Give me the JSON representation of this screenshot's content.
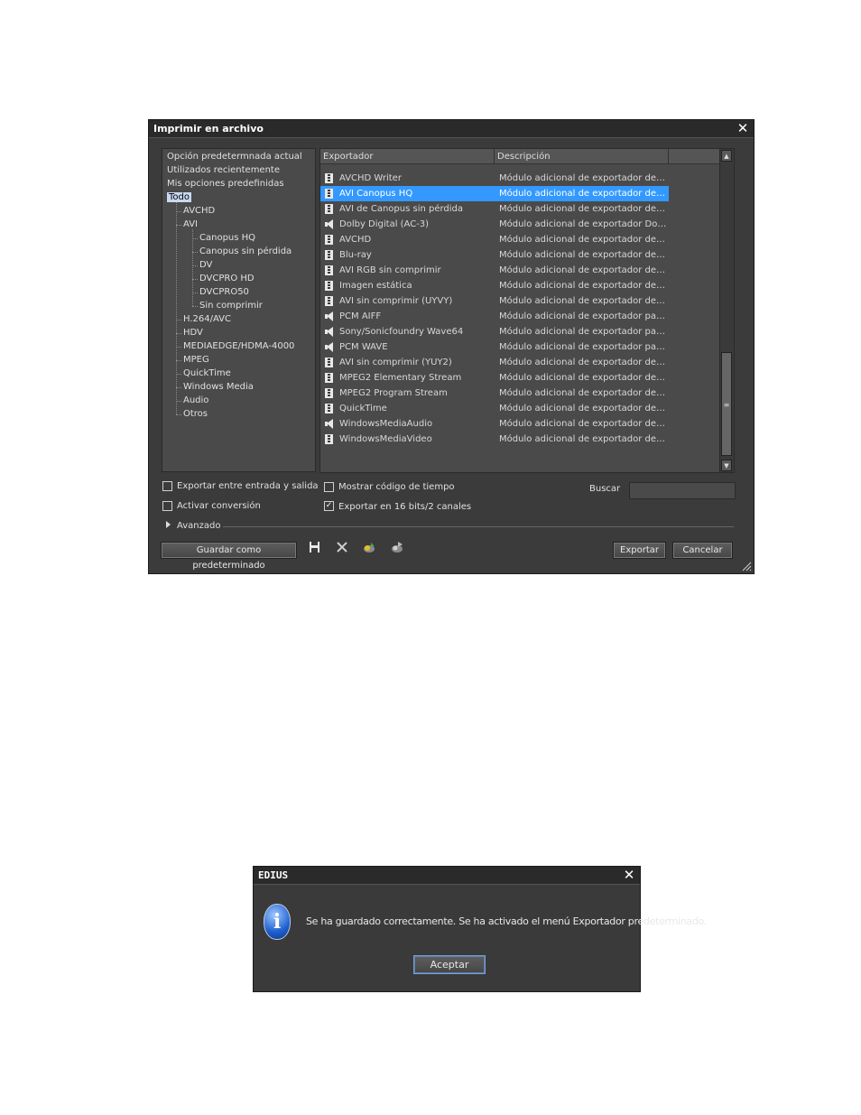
{
  "export_dialog": {
    "title": "Imprimir en archivo",
    "tree": [
      {
        "label": "Opción predetermnada actual",
        "level": 0
      },
      {
        "label": "Utilizados recientemente",
        "level": 0
      },
      {
        "label": "Mis opciones predefinidas",
        "level": 0
      },
      {
        "label": "Todo",
        "level": 0,
        "selected": true
      },
      {
        "label": "AVCHD",
        "level": 1
      },
      {
        "label": "AVI",
        "level": 1
      },
      {
        "label": "Canopus HQ",
        "level": 2
      },
      {
        "label": "Canopus sin pérdida",
        "level": 2
      },
      {
        "label": "DV",
        "level": 2
      },
      {
        "label": "DVCPRO HD",
        "level": 2
      },
      {
        "label": "DVCPRO50",
        "level": 2
      },
      {
        "label": "Sin comprimir",
        "level": 2
      },
      {
        "label": "H.264/AVC",
        "level": 1
      },
      {
        "label": "HDV",
        "level": 1
      },
      {
        "label": "MEDIAEDGE/HDMA-4000",
        "level": 1
      },
      {
        "label": "MPEG",
        "level": 1
      },
      {
        "label": "QuickTime",
        "level": 1
      },
      {
        "label": "Windows Media",
        "level": 1
      },
      {
        "label": "Audio",
        "level": 1
      },
      {
        "label": "Otros",
        "level": 1
      }
    ],
    "columns": {
      "exporter": "Exportador",
      "description": "Descripción"
    },
    "rows": [
      {
        "name": "AVCHD Writer",
        "desc": "Módulo adicional de exportador de for…",
        "icon": "film"
      },
      {
        "name": "AVI Canopus HQ",
        "desc": "Módulo adicional de exportador de ar…",
        "icon": "film",
        "selected": true
      },
      {
        "name": "AVI de Canopus sin pérdida",
        "desc": "Módulo adicional de exportador de ar…",
        "icon": "film"
      },
      {
        "name": "Dolby Digital (AC-3)",
        "desc": "Módulo adicional de exportador Dolby…",
        "icon": "speaker"
      },
      {
        "name": "AVCHD",
        "desc": "Módulo adicional de exportador de AV…",
        "icon": "film"
      },
      {
        "name": "Blu-ray",
        "desc": "Módulo adicional de exportador de Blu…",
        "icon": "film"
      },
      {
        "name": "AVI RGB sin comprimir",
        "desc": "Módulo adicional de exportador de ar…",
        "icon": "film"
      },
      {
        "name": "Imagen estática",
        "desc": "Módulo adicional de exportador de im…",
        "icon": "film"
      },
      {
        "name": "AVI sin comprimir (UYVY)",
        "desc": "Módulo adicional de exportador de ar…",
        "icon": "film"
      },
      {
        "name": "PCM AIFF",
        "desc": "Módulo adicional de exportador para …",
        "icon": "speaker"
      },
      {
        "name": "Sony/Sonicfoundry Wave64",
        "desc": "Módulo adicional de exportador para …",
        "icon": "speaker"
      },
      {
        "name": "PCM WAVE",
        "desc": "Módulo adicional de exportador para …",
        "icon": "speaker"
      },
      {
        "name": "AVI sin comprimir (YUY2)",
        "desc": "Módulo adicional de exportador de ar…",
        "icon": "film"
      },
      {
        "name": "MPEG2 Elementary Stream",
        "desc": "Módulo adicional de exportador de MP…",
        "icon": "film"
      },
      {
        "name": "MPEG2 Program Stream",
        "desc": "Módulo adicional de exportador de MP…",
        "icon": "film"
      },
      {
        "name": "QuickTime",
        "desc": "Módulo adicional de exportador de Qu…",
        "icon": "film"
      },
      {
        "name": "WindowsMediaAudio",
        "desc": "Módulo adicional de exportador de W…",
        "icon": "speaker"
      },
      {
        "name": "WindowsMediaVideo",
        "desc": "Módulo adicional de exportador de W…",
        "icon": "film"
      }
    ],
    "options": {
      "export_in_out": {
        "label": "Exportar entre entrada y salida",
        "checked": false
      },
      "enable_conversion": {
        "label": "Activar conversión",
        "checked": false
      },
      "show_timecode": {
        "label": "Mostrar código de tiempo",
        "checked": false
      },
      "export_16bit": {
        "label": "Exportar en 16 bits/2 canales",
        "checked": true
      },
      "search_label": "Buscar",
      "search_value": ""
    },
    "advanced_label": "Avanzado",
    "save_default_label": "Guardar como predeterminado",
    "export_label": "Exportar",
    "cancel_label": "Cancelar"
  },
  "message_dialog": {
    "title": "EDIUS",
    "message": "Se ha guardado correctamente. Se ha activado el menú Exportador predeterminado.",
    "ok_label": "Aceptar"
  }
}
